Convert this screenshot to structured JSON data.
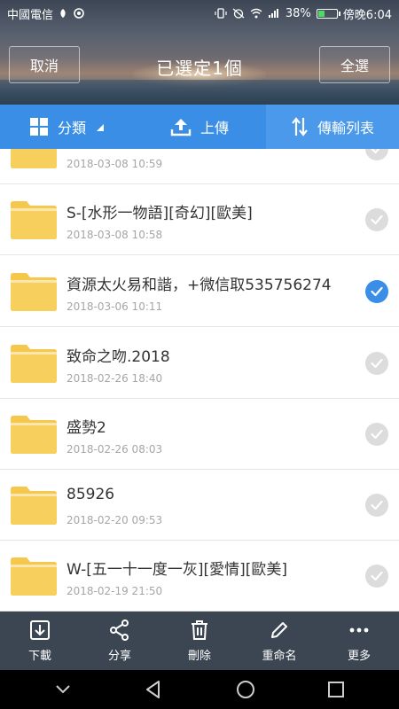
{
  "status_bar": {
    "carrier": "中國電信",
    "battery_percent": "38%",
    "time": "傍晚6:04",
    "battery_level": 0.38
  },
  "header": {
    "cancel_label": "取消",
    "title": "已選定1個",
    "select_all_label": "全選"
  },
  "tabs": [
    {
      "label": "分類",
      "icon": "grid-icon"
    },
    {
      "label": "上傳",
      "icon": "upload-icon"
    },
    {
      "label": "傳輸列表",
      "icon": "transfer-icon"
    }
  ],
  "files": [
    {
      "name": "",
      "date": "2018-03-08 10:59",
      "checked": false
    },
    {
      "name": "S-[水形一物語][奇幻][歐美]",
      "date": "2018-03-08 10:58",
      "checked": false
    },
    {
      "name": "資源太火易和諧，+微信取535756274",
      "date": "2018-03-06 10:11",
      "checked": true
    },
    {
      "name": "致命之吻.2018",
      "date": "2018-02-26 18:40",
      "checked": false
    },
    {
      "name": "盛勢2",
      "date": "2018-02-26 08:03",
      "checked": false
    },
    {
      "name": "85926",
      "date": "2018-02-20 09:53",
      "checked": false
    },
    {
      "name": "W-[五一十一度一灰][愛情][歐美]",
      "date": "2018-02-19 21:50",
      "checked": false
    }
  ],
  "toolbar": [
    {
      "label": "下載",
      "icon": "download-icon"
    },
    {
      "label": "分享",
      "icon": "share-icon"
    },
    {
      "label": "刪除",
      "icon": "trash-icon"
    },
    {
      "label": "重命名",
      "icon": "pencil-icon"
    },
    {
      "label": "更多",
      "icon": "more-icon"
    }
  ],
  "colors": {
    "accent": "#3a8ee6",
    "folder": "#f5c84c",
    "toolbar": "#3c4652"
  }
}
